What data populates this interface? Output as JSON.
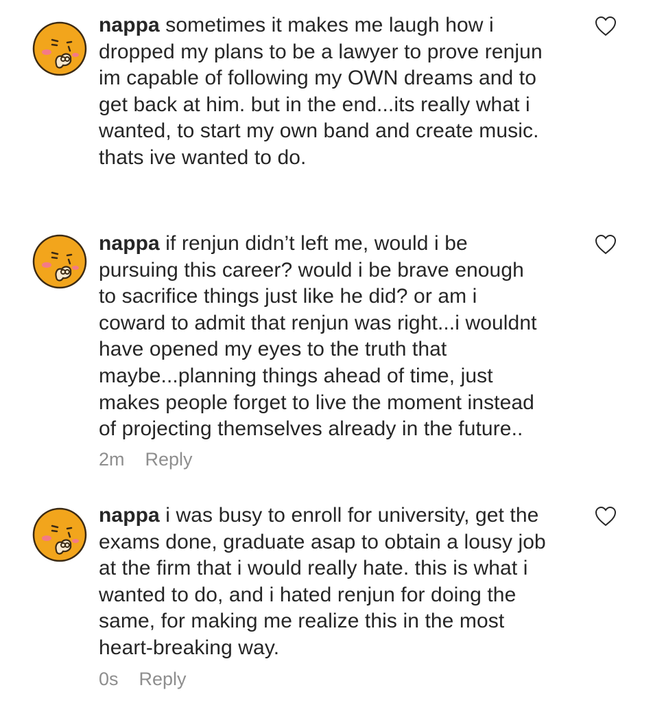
{
  "comments": [
    {
      "username": "nappa",
      "text": "sometimes it makes me laugh how i\ndropped my plans to be a lawyer to prove renjun\nim capable of following my OWN dreams and to\nget back at him. but in the end...its really what i\nwanted, to start my own band and create music.\nthats ive wanted to do.",
      "avatar_icon": "kakao-face-avatar-icon",
      "like_icon": "heart-outline-icon"
    },
    {
      "username": "nappa",
      "text": "if renjun didn’t left me, would i be\npursuing this career? would i be brave enough\nto sacrifice things just like he did? or am i\ncoward to admit that renjun was right...i wouldnt\nhave opened my eyes to the truth that\nmaybe...planning things ahead of time, just\nmakes people forget to live the moment instead\nof projecting themselves already in the future..",
      "time": "2m",
      "reply_label": "Reply",
      "avatar_icon": "kakao-face-avatar-icon",
      "like_icon": "heart-outline-icon"
    },
    {
      "username": "nappa",
      "text": "i was busy to enroll for university, get the\nexams done, graduate asap to obtain a lousy job\nat the firm that i would really hate. this is what i\nwanted to do, and i hated renjun for doing the\nsame, for making me realize this in the most\nheart-breaking way.",
      "time": "0s",
      "reply_label": "Reply",
      "avatar_icon": "kakao-face-avatar-icon",
      "like_icon": "heart-outline-icon"
    }
  ],
  "colors": {
    "text": "#262626",
    "meta": "#8e8e8e",
    "avatar_fill": "#f2a51c",
    "avatar_outline": "#3b2a14",
    "blush": "#f47a86"
  }
}
